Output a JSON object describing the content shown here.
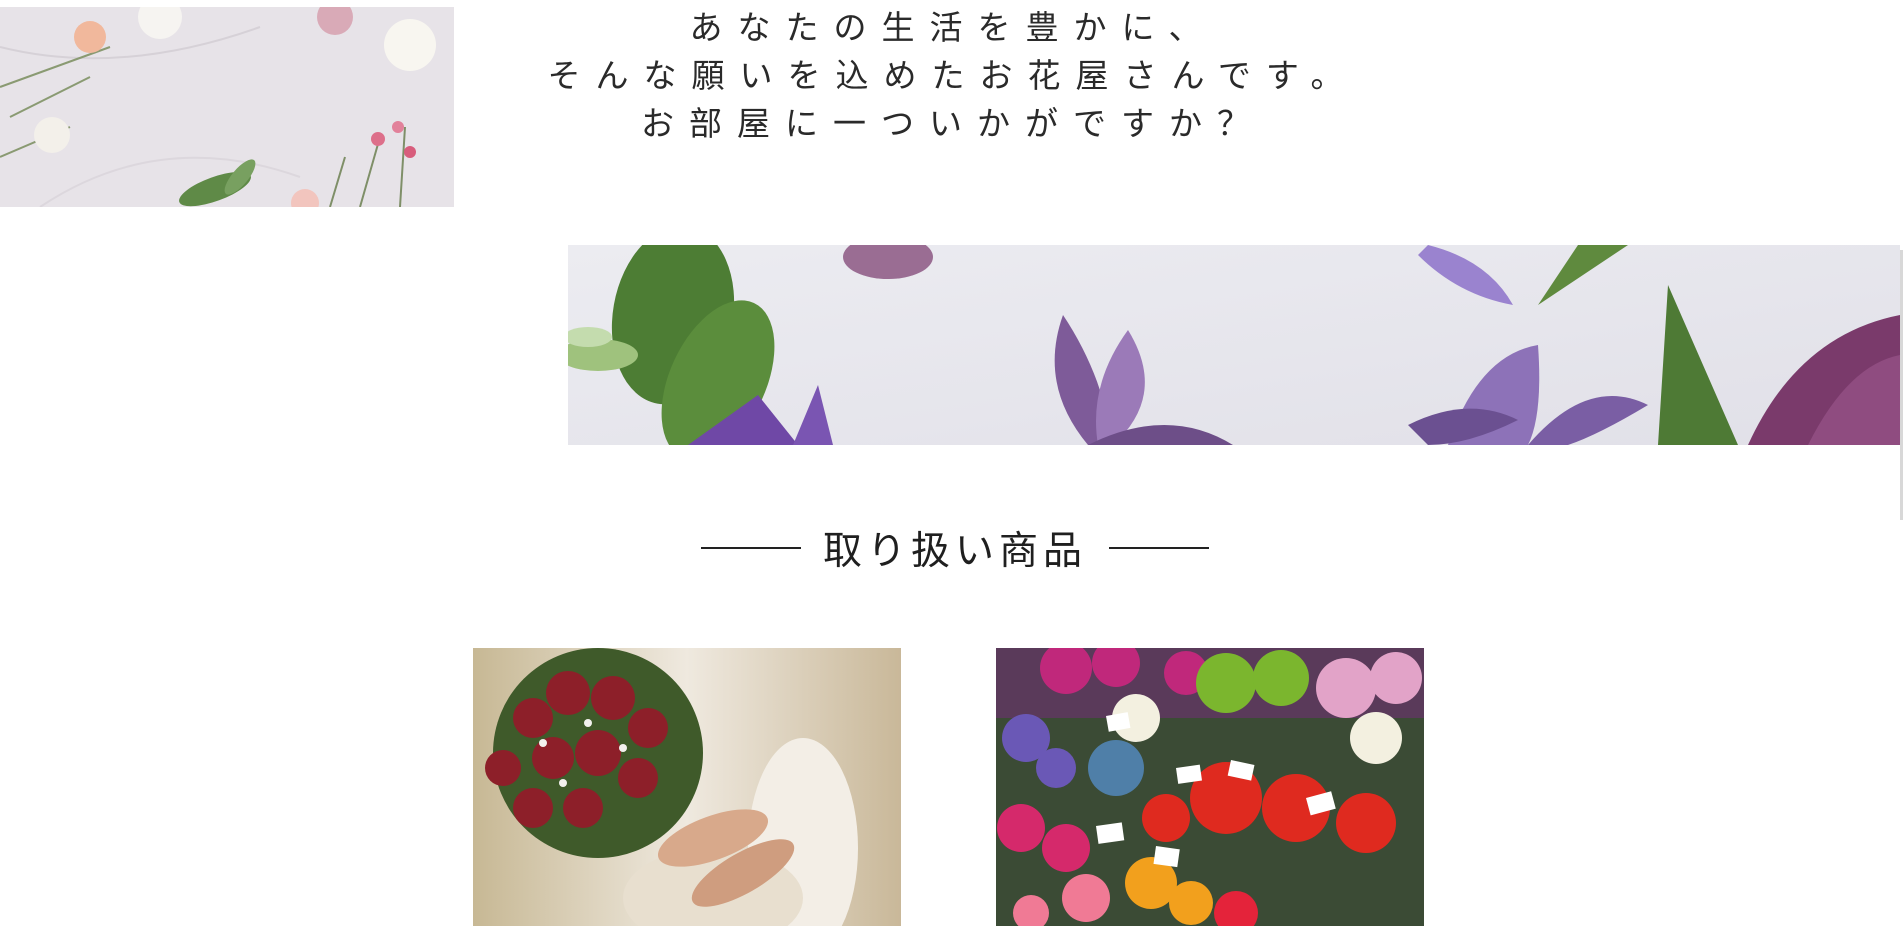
{
  "intro": {
    "lines": [
      "あなたの生活を豊かに、",
      "そんな願いを込めたお花屋さんです。",
      "お部屋に一ついかがですか？"
    ]
  },
  "images": {
    "top_left": "flat-lay-flowers-photo",
    "banner": "purple-flowers-banner-photo",
    "bouquet": "red-rose-bouquet-photo",
    "market": "flower-market-photo"
  },
  "products_section": {
    "heading": "取り扱い商品"
  },
  "colors": {
    "text": "#222222",
    "background": "#ffffff",
    "marble": "#e6e2e6",
    "banner_bg": "#e9e8ee",
    "clematis": "#8a6aa8",
    "rose": "#8e1c24",
    "leaf": "#4f7a3a"
  }
}
